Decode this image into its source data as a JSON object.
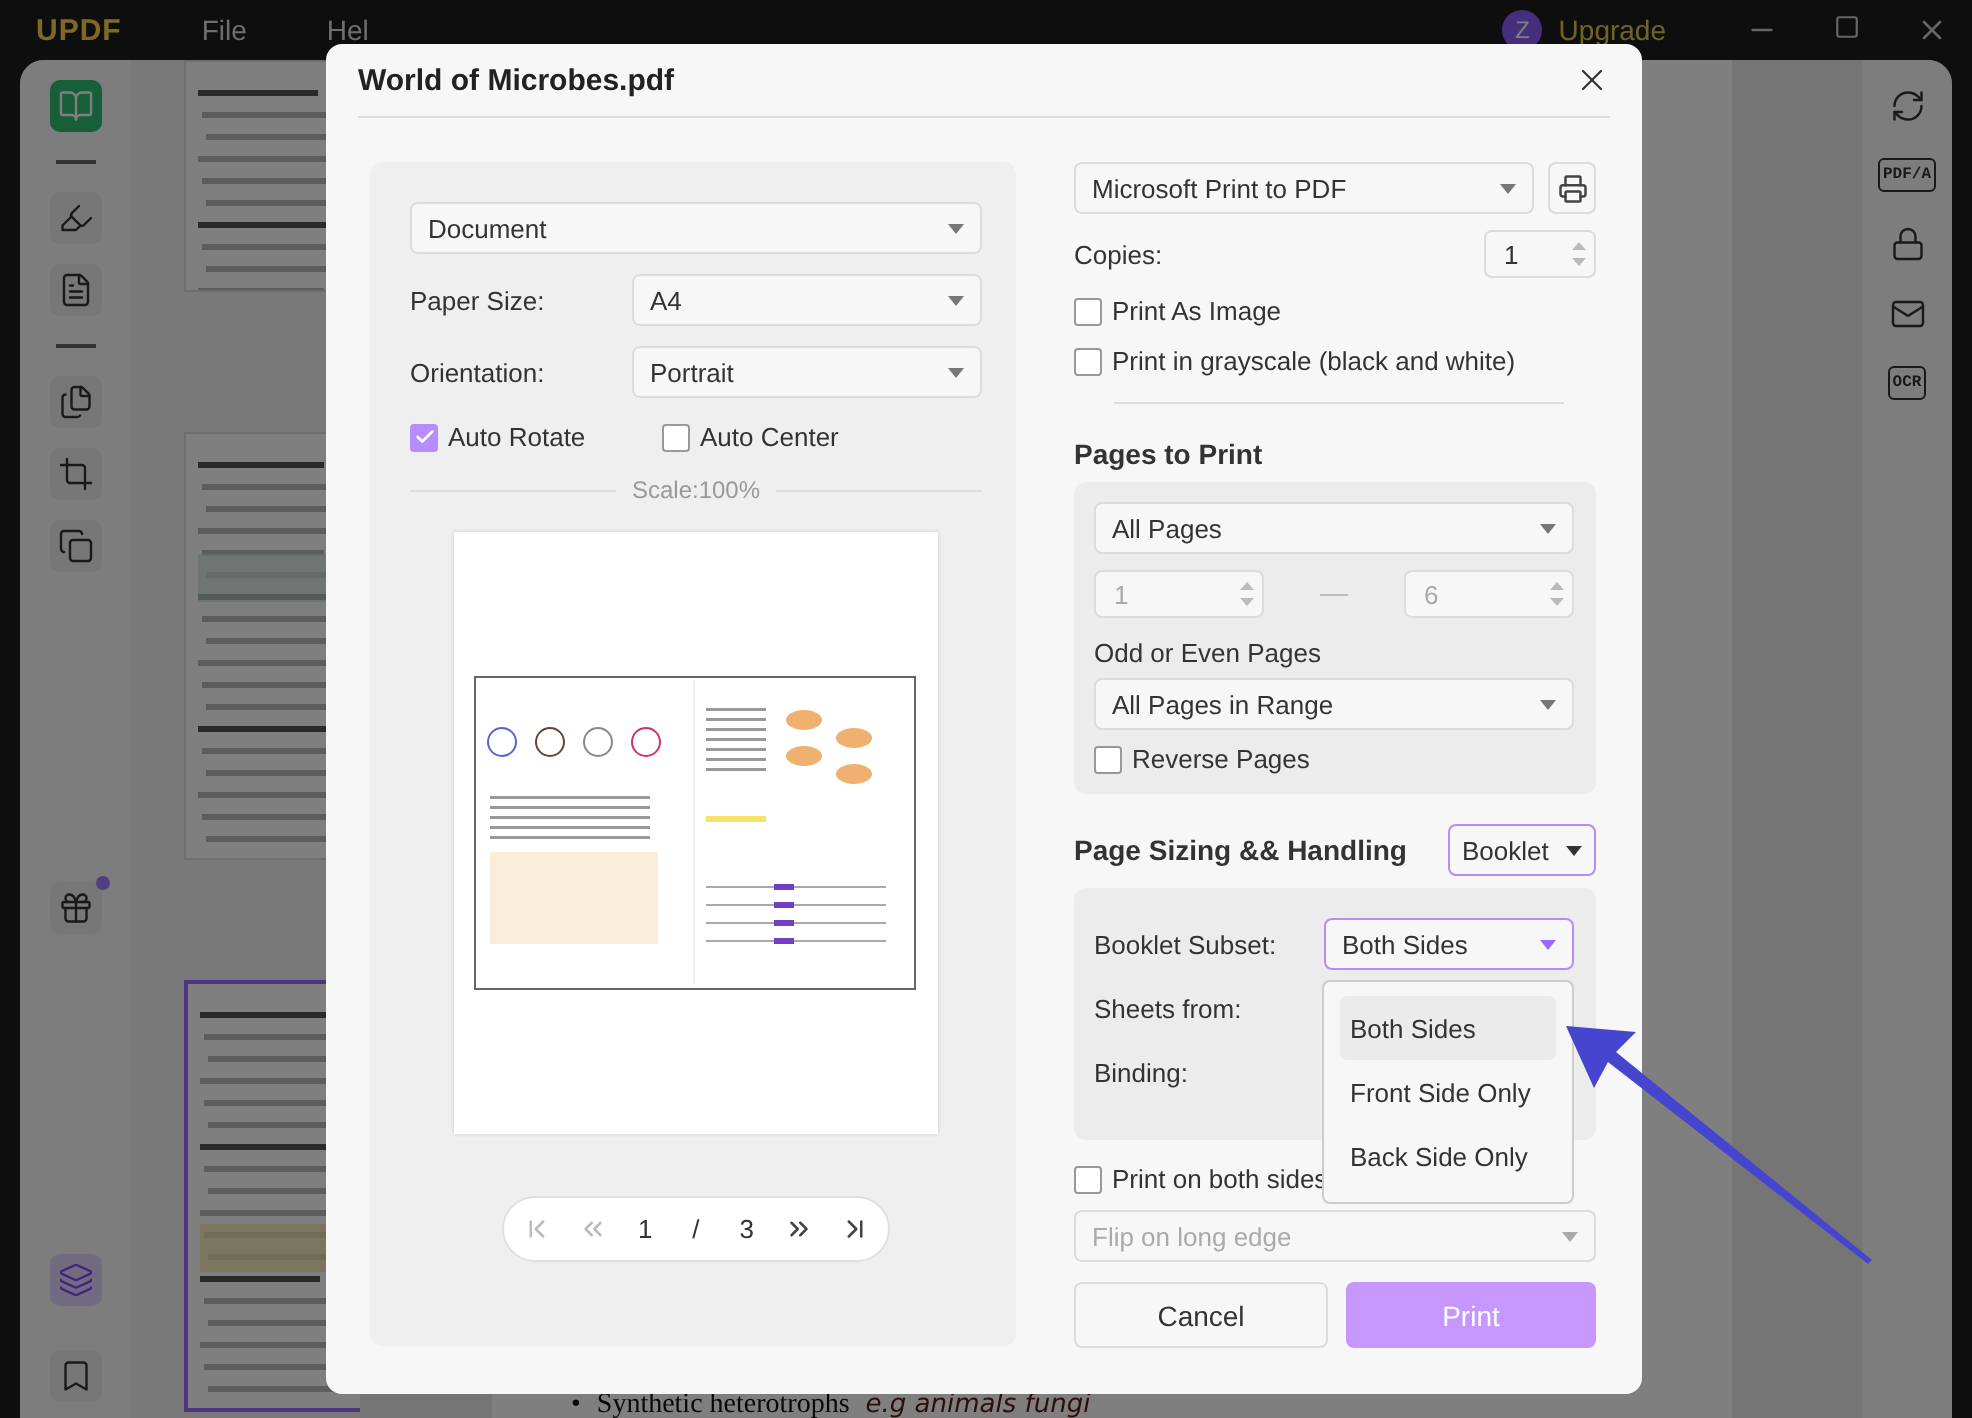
{
  "app": {
    "logo": "UPDF",
    "menu": [
      "File",
      "Hel"
    ],
    "avatar": "Z",
    "upgrade": "Upgrade"
  },
  "tool_groups": [
    [
      {
        "kind": "read",
        "selected": true
      }
    ],
    [
      {
        "kind": "comment",
        "selected": false
      },
      {
        "kind": "edit",
        "selected": false
      }
    ],
    [
      {
        "kind": "organize",
        "selected": false
      },
      {
        "kind": "crop",
        "selected": false
      },
      {
        "kind": "compare",
        "selected": false
      }
    ]
  ],
  "bottom_tools": [
    {
      "kind": "gift",
      "selected": false,
      "badge": true
    },
    {
      "kind": "layers",
      "selected": true
    },
    {
      "kind": "bookmark",
      "selected": false
    }
  ],
  "thumbnails": [
    {
      "selected": false
    },
    {
      "selected": false
    },
    {
      "selected": true
    }
  ],
  "document": {
    "bullet_mark": "•",
    "bullet": "Synthetic heterotrophs",
    "note": "e.g animals fungi"
  },
  "right_tools": [
    {
      "kind": "convert"
    },
    {
      "kind": "label",
      "label": "PDF/A"
    },
    {
      "kind": "protect"
    },
    {
      "kind": "mail"
    },
    {
      "kind": "label",
      "label": "OCR"
    }
  ],
  "dialog": {
    "title": "World of Microbes.pdf",
    "layout": {
      "preset": "Document",
      "fields": [
        {
          "label": "Paper Size:",
          "value": "A4"
        },
        {
          "label": "Orientation:",
          "value": "Portrait"
        }
      ],
      "checks": [
        {
          "label": "Auto Rotate",
          "checked": true
        },
        {
          "label": "Auto Center",
          "checked": false
        }
      ],
      "scale": "Scale:100%"
    },
    "pager": {
      "buttons": [
        {
          "kind": "first",
          "disabled": true
        },
        {
          "kind": "prev",
          "disabled": true
        },
        {
          "kind": "next",
          "disabled": false
        },
        {
          "kind": "last",
          "disabled": false
        }
      ],
      "current": "1",
      "separator": "/",
      "total": "3"
    },
    "printer": "Microsoft Print to PDF",
    "copies": {
      "label": "Copies:",
      "value": "1"
    },
    "print_checks": [
      {
        "label": "Print As Image",
        "checked": false
      },
      {
        "label": "Print in grayscale (black and white)",
        "checked": false
      }
    ],
    "pages": {
      "heading": "Pages to Print",
      "range": "All Pages",
      "from": "1",
      "to": "6",
      "range_disabled": true,
      "subset_label": "Odd or Even Pages",
      "subset": "All Pages in Range",
      "reverse": {
        "label": "Reverse Pages",
        "checked": false
      }
    },
    "sizing": {
      "heading": "Page Sizing && Handling",
      "mode": "Booklet",
      "rows": [
        {
          "label": "Booklet Subset:",
          "value": "Both Sides",
          "open": true
        },
        {
          "label": "Sheets from:"
        },
        {
          "label": "Binding:"
        }
      ],
      "menu": [
        {
          "label": "Both Sides",
          "selected": true
        },
        {
          "label": "Front Side Only",
          "selected": false
        },
        {
          "label": "Back Side Only",
          "selected": false
        }
      ]
    },
    "duplex": {
      "label": "Print on both sides",
      "checked": false
    },
    "flip": {
      "placeholder": "Flip on long edge",
      "disabled": true
    },
    "buttons": [
      {
        "kind": "secondary",
        "label": "Cancel"
      },
      {
        "kind": "primary",
        "label": "Print"
      }
    ]
  }
}
